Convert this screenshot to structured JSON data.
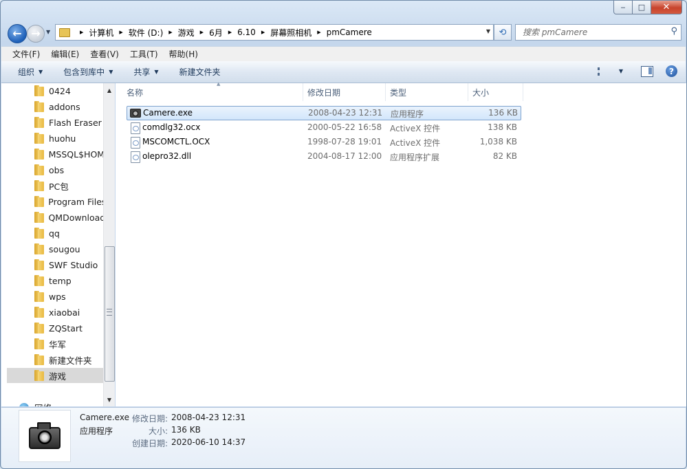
{
  "window": {
    "minimize": "‒",
    "maximize": "□",
    "close": "✕"
  },
  "address": {
    "crumbs": [
      "计算机",
      "软件 (D:)",
      "游戏",
      "6月",
      "6.10",
      "屏幕照相机",
      "pmCamere"
    ],
    "search_placeholder": "搜索 pmCamere"
  },
  "menu": [
    "文件(F)",
    "编辑(E)",
    "查看(V)",
    "工具(T)",
    "帮助(H)"
  ],
  "commands": {
    "organize": "组织",
    "include_library": "包含到库中",
    "share": "共享",
    "new_folder": "新建文件夹"
  },
  "nav_tree": [
    "0424",
    "addons",
    "Flash Eraser",
    "huohu",
    "MSSQL$HOM",
    "obs",
    "PC包",
    "Program Files",
    "QMDownload",
    "qq",
    "sougou",
    "SWF Studio",
    "temp",
    "wps",
    "xiaobai",
    "ZQStart",
    "华军",
    "新建文件夹",
    "游戏"
  ],
  "nav_selected": "游戏",
  "network_label": "网络",
  "columns": {
    "name": "名称",
    "date": "修改日期",
    "type": "类型",
    "size": "大小"
  },
  "files": [
    {
      "name": "Camere.exe",
      "date": "2008-04-23 12:31",
      "type": "应用程序",
      "size": "136 KB",
      "icon": "camera-icon",
      "selected": true
    },
    {
      "name": "comdlg32.ocx",
      "date": "2000-05-22 16:58",
      "type": "ActiveX 控件",
      "size": "138 KB",
      "icon": "ocx-file-icon"
    },
    {
      "name": "MSCOMCTL.OCX",
      "date": "1998-07-28 19:01",
      "type": "ActiveX 控件",
      "size": "1,038 KB",
      "icon": "ocx-file-icon"
    },
    {
      "name": "olepro32.dll",
      "date": "2004-08-17 12:00",
      "type": "应用程序扩展",
      "size": "82 KB",
      "icon": "dll-file-icon"
    }
  ],
  "details": {
    "filename": "Camere.exe",
    "filetype": "应用程序",
    "modified_label": "修改日期:",
    "modified": "2008-04-23 12:31",
    "size_label": "大小:",
    "size": "136 KB",
    "created_label": "创建日期:",
    "created": "2020-06-10 14:37"
  }
}
